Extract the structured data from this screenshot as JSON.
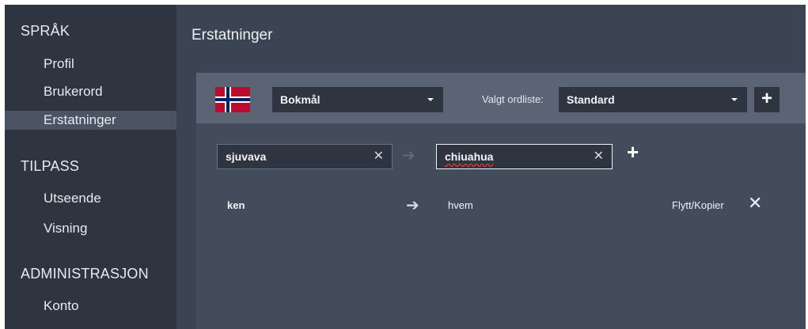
{
  "sidebar": {
    "section_language": "SPRÅK",
    "items_language": [
      "Profil",
      "Brukerord",
      "Erstatninger"
    ],
    "section_customize": "TILPASS",
    "items_customize": [
      "Utseende",
      "Visning"
    ],
    "section_admin": "ADMINISTRASJON",
    "items_admin": [
      "Konto"
    ]
  },
  "main": {
    "title": "Erstatninger"
  },
  "panel": {
    "flag_icon": "norway-flag-icon",
    "language": "Bokmål",
    "list_label": "Valgt ordliste:",
    "list": "Standard",
    "add_list": "+",
    "from_value": "sjuvava",
    "to_value": "chiuahua",
    "clear_glyph": "✕",
    "arrow_glyph": "➔",
    "add_entry": "+",
    "entries": [
      {
        "from": "ken",
        "to": "hvem",
        "move_copy": "Flytt/Kopier",
        "delete": "✕"
      }
    ]
  },
  "colors": {
    "sidebar_bg": "#2e3440",
    "main_bg": "#3b4453",
    "panel_header": "#5a6475",
    "active_item": "#4a5463"
  }
}
